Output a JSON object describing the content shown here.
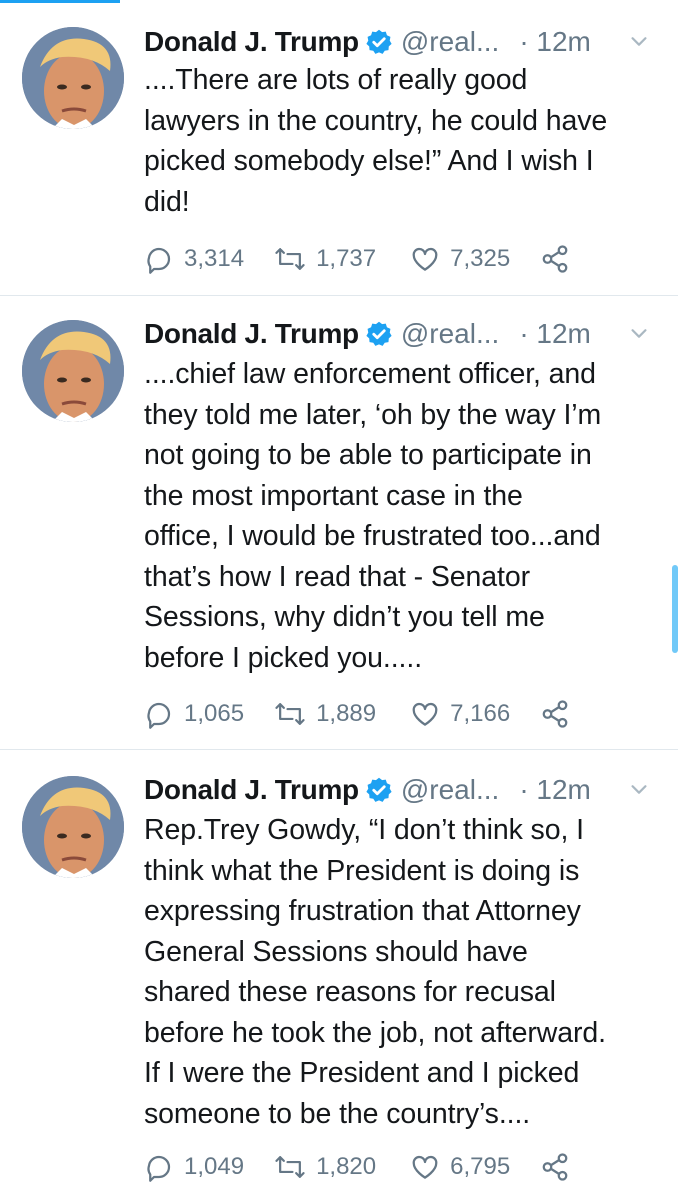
{
  "tweets": [
    {
      "author_name": "Donald J. Trump",
      "handle": "@real...",
      "time": "· 12m",
      "text": "....There are lots of really good\nlawyers in the country, he could have\npicked somebody else!” And I wish I\ndid!",
      "replies": "3,314",
      "retweets": "1,737",
      "likes": "7,325"
    },
    {
      "author_name": "Donald J. Trump",
      "handle": "@real...",
      "time": "· 12m",
      "text": "....chief law enforcement officer, and\nthey told me later, ‘oh by the way I’m\nnot going to be able to participate in\nthe most important case in the\noffice, I would be frustrated too...and\nthat’s how I read that - Senator\nSessions, why didn’t you tell me\nbefore I picked you.....",
      "replies": "1,065",
      "retweets": "1,889",
      "likes": "7,166"
    },
    {
      "author_name": "Donald J. Trump",
      "handle": "@real...",
      "time": "· 12m",
      "text": "Rep.Trey Gowdy, “I don’t think so, I\nthink what the President is doing is\nexpressing frustration that Attorney\nGeneral Sessions should have\nshared these reasons for recusal\nbefore he took the job, not afterward.\nIf I were the President and I picked\nsomeone to be the country’s....",
      "replies": "1,049",
      "retweets": "1,820",
      "likes": "6,795"
    }
  ],
  "icons": {
    "verified": "verified-badge-icon",
    "menu": "chevron-down-icon",
    "reply": "reply-icon",
    "retweet": "retweet-icon",
    "like": "heart-icon",
    "share": "share-icon"
  },
  "colors": {
    "accent": "#1da1f2",
    "text": "#14171a",
    "secondary": "#657786",
    "divider": "#e1e8ed",
    "scrollbar": "#71c9f8"
  }
}
